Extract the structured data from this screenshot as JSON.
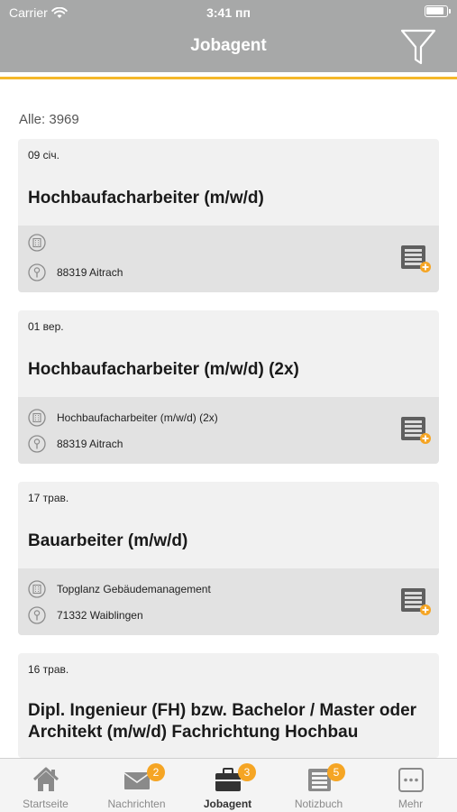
{
  "status_bar": {
    "carrier": "Carrier",
    "time": "3:41 пп"
  },
  "header": {
    "title": "Jobagent",
    "filter_icon": "filter-icon"
  },
  "colors": {
    "header_bg": "#a7a8a8",
    "accent": "#f5b82a",
    "badge": "#f5a524"
  },
  "count_label": "Alle: 3969",
  "jobs": [
    {
      "date": "09 січ.",
      "title": "Hochbaufacharbeiter (m/w/d)",
      "company": "",
      "location": "88319 Aitrach"
    },
    {
      "date": "01 вер.",
      "title": "Hochbaufacharbeiter (m/w/d) (2x)",
      "company": "Hochbaufacharbeiter (m/w/d) (2x)",
      "location": "88319 Aitrach"
    },
    {
      "date": "17 трав.",
      "title": "Bauarbeiter (m/w/d)",
      "company": "Topglanz Gebäudemanagement",
      "location": "71332 Waiblingen"
    },
    {
      "date": "16 трав.",
      "title_line1": "Dipl. Ingenieur (FH) bzw. Bachelor / Master oder",
      "title_line2": "Architekt (m/w/d) Fachrichtung Hochbau"
    }
  ],
  "tabs": [
    {
      "label": "Startseite",
      "icon": "home-icon",
      "badge": ""
    },
    {
      "label": "Nachrichten",
      "icon": "envelope-icon",
      "badge": "2"
    },
    {
      "label": "Jobagent",
      "icon": "briefcase-icon",
      "badge": "3"
    },
    {
      "label": "Notizbuch",
      "icon": "notebook-icon",
      "badge": "5"
    },
    {
      "label": "Mehr",
      "icon": "more-icon",
      "badge": ""
    }
  ]
}
